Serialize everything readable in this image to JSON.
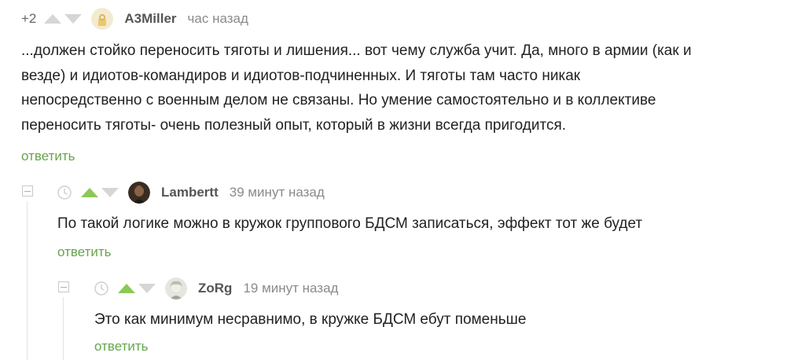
{
  "comments": [
    {
      "rating": "+2",
      "author": "A3Miller",
      "time": "час назад",
      "lines": [
        "...должен стойко переносить тяготы и лишения... вот чему служба учит. Да, много в армии (как и",
        "везде) и идиотов-командиров и идиотов-подчиненных. И тяготы там часто никак",
        "непосредственно с военным делом не связаны. Но умение самостоятельно и в коллективе",
        "переносить тяготы- очень полезный опыт, который в жизни всегда пригодится."
      ],
      "reply_label": "ответить"
    },
    {
      "author": "Lambertt",
      "time": "39 минут назад",
      "text": "По такой логике можно в кружок группового БДСМ записаться, эффект тот же будет",
      "reply_label": "ответить"
    },
    {
      "author": "ZoRg",
      "time": "19 минут назад",
      "text": "Это как минимум несравнимо, в кружке БДСМ ебут поменьше",
      "reply_label": "ответить"
    }
  ],
  "colors": {
    "accent": "#65a64a",
    "upvote": "#8ac858",
    "muted": "#8a8a8a"
  }
}
